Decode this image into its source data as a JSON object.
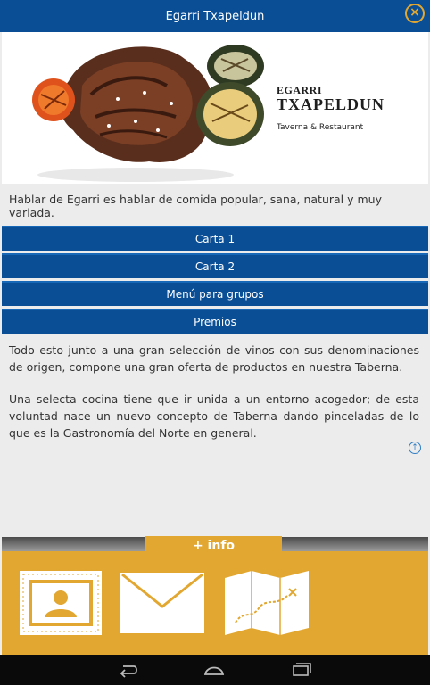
{
  "app": {
    "title": "Egarri Txapeldun"
  },
  "colors": {
    "primary": "#0a4e96",
    "accent": "#e2a730",
    "background": "#ececec"
  },
  "hero": {
    "brand_line1": "EGARRI",
    "brand_line2": "TXAPELDUN",
    "brand_tagline": "Taverna & Restaurant"
  },
  "intro": "Hablar de Egarri es hablar de comida popular, sana, natural y muy variada.",
  "menu": [
    {
      "label": "Carta 1"
    },
    {
      "label": "Carta 2"
    },
    {
      "label": "Menú para grupos"
    },
    {
      "label": "Premios"
    }
  ],
  "body": {
    "p1": "Todo esto junto a una gran selección de vinos con sus denominaciones de origen, compone una gran oferta de productos en nuestra Taberna.",
    "p2": "Una selecta cocina tiene que ir unida a un entorno acogedor; de esta voluntad nace un nuevo concepto de Taberna dando pinceladas de lo que es la Gastronomía del Norte en general."
  },
  "info_tab": "+ info",
  "info_icons": [
    "contact-card-icon",
    "mail-icon",
    "map-icon"
  ],
  "system_nav": [
    "back-icon",
    "home-icon",
    "recents-icon"
  ]
}
